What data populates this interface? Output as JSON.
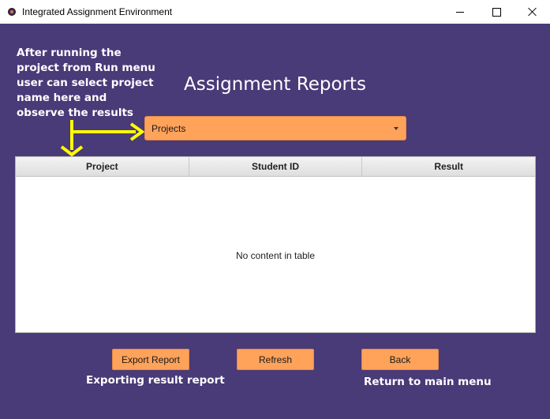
{
  "window": {
    "title": "Integrated Assignment Environment",
    "controls": [
      "minimize",
      "maximize",
      "close"
    ]
  },
  "annotations": {
    "top_note": [
      "After running the",
      "project from Run menu",
      "user can select project",
      "name  here and",
      "observe the results"
    ],
    "export_note": "Exporting result report",
    "back_note": "Return to main menu"
  },
  "page": {
    "title": "Assignment Reports"
  },
  "project_select": {
    "value": "Projects"
  },
  "table": {
    "columns": [
      "Project",
      "Student ID",
      "Result"
    ],
    "empty_message": "No content in table"
  },
  "buttons": {
    "export": "Export Report",
    "refresh": "Refresh",
    "back": "Back"
  },
  "colors": {
    "background": "#493a78",
    "accent": "#ffa25a",
    "arrow": "#ffff00",
    "text_on_background": "#ffffff"
  }
}
